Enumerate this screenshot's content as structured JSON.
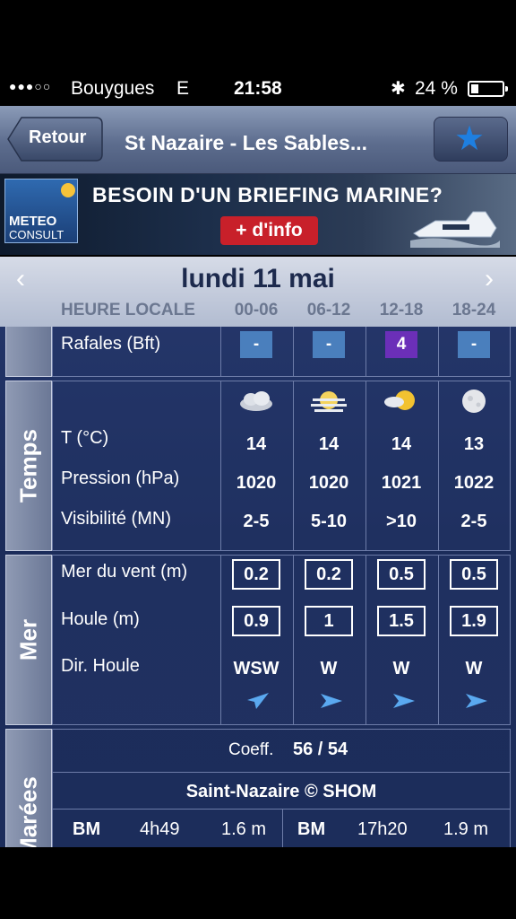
{
  "status": {
    "signal": "●●●○○",
    "carrier": "Bouygues",
    "network": "E",
    "time": "21:58",
    "bluetooth": "✱",
    "battery": "24 %",
    "battery_level": 0.24
  },
  "nav": {
    "back_label": "Retour",
    "title": "St Nazaire - Les Sables...",
    "favorite_icon": "star-icon"
  },
  "banner": {
    "logo_line1": "METEO",
    "logo_line2": "CONSULT",
    "headline": "BESOIN D'UN BRIEFING MARINE?",
    "cta": "+ d'info"
  },
  "day": {
    "prev": "‹",
    "next": "›",
    "label": "lundi 11 mai",
    "local_time_label": "HEURE LOCALE",
    "slots": [
      "00-06",
      "06-12",
      "12-18",
      "18-24"
    ]
  },
  "rafales": {
    "label": "Rafales (Bft)",
    "values": [
      "-",
      "-",
      "4",
      "-"
    ],
    "colors": [
      "#4a7fbd",
      "#4a7fbd",
      "#6b2fb8",
      "#4a7fbd"
    ]
  },
  "temps": {
    "section_label": "Temps",
    "icons": [
      "cloudy-night-icon",
      "sun-haze-icon",
      "sun-cloud-icon",
      "moon-icon"
    ],
    "rows": [
      {
        "label": "T (°C)",
        "values": [
          "14",
          "14",
          "14",
          "13"
        ]
      },
      {
        "label": "Pression (hPa)",
        "values": [
          "1020",
          "1020",
          "1021",
          "1022"
        ]
      },
      {
        "label": "Visibilité (MN)",
        "values": [
          "2-5",
          "5-10",
          ">10",
          "2-5"
        ]
      }
    ]
  },
  "mer": {
    "section_label": "Mer",
    "rows": [
      {
        "label": "Mer du vent (m)",
        "values": [
          "0.2",
          "0.2",
          "0.5",
          "0.5"
        ]
      },
      {
        "label": "Houle (m)",
        "values": [
          "0.9",
          "1",
          "1.5",
          "1.9"
        ]
      },
      {
        "label": "Dir. Houle",
        "values": [
          "WSW",
          "W",
          "W",
          "W"
        ]
      }
    ]
  },
  "marees": {
    "section_label": "Marées",
    "coeff_label": "Coeff.",
    "coeff_value": "56 / 54",
    "source": "Saint-Nazaire © SHOM",
    "tides": [
      {
        "type": "BM",
        "time": "4h49",
        "height": "1.6 m"
      },
      {
        "type": "BM",
        "time": "17h20",
        "height": "1.9 m"
      }
    ]
  }
}
